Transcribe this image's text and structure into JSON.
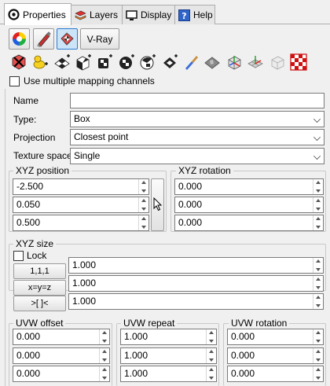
{
  "tabs": [
    {
      "label": "Properties",
      "icon": "properties-icon",
      "active": true
    },
    {
      "label": "Layers",
      "icon": "layers-icon",
      "active": false
    },
    {
      "label": "Display",
      "icon": "display-icon",
      "active": false
    },
    {
      "label": "Help",
      "icon": "help-icon",
      "active": false
    }
  ],
  "toolbar": {
    "buttons": [
      "color-wheel-icon",
      "paint-tube-icon",
      "texture-mapping-icon"
    ],
    "vray_label": "V-Ray"
  },
  "mapping_icons": [
    "remove-mapping-icon",
    "add-mapping-icon",
    "planar-mapping-icon",
    "box-mapping-icon",
    "cylinder-mapping-icon",
    "sphere-mapping-icon",
    "surface-mapping-icon",
    "capped-mapping-icon",
    "brush-icon",
    "show-mapping-icon",
    "box-widget-icon",
    "grid-widget-icon",
    "grid-faded-icon",
    "checker-icon"
  ],
  "multi_channel": {
    "label": "Use multiple mapping channels",
    "checked": false
  },
  "props": {
    "name_label": "Name",
    "name_value": "",
    "type_label": "Type:",
    "type_value": "Box",
    "projection_label": "Projection",
    "projection_value": "Closest point",
    "texture_space_label": "Texture space",
    "texture_space_value": "Single"
  },
  "xyz_position": {
    "title": "XYZ position",
    "values": [
      "-2.500",
      "0.050",
      "0.500"
    ]
  },
  "xyz_rotation": {
    "title": "XYZ rotation",
    "values": [
      "0.000",
      "0.000",
      "0.000"
    ]
  },
  "xyz_size": {
    "title": "XYZ size",
    "lock_label": "Lock",
    "lock_checked": false,
    "buttons": [
      "1,1,1",
      "x=y=z",
      ">[ ]<"
    ],
    "values": [
      "1.000",
      "1.000",
      "1.000"
    ]
  },
  "uvw_offset": {
    "title": "UVW offset",
    "values": [
      "0.000",
      "0.000",
      "0.000"
    ]
  },
  "uvw_repeat": {
    "title": "UVW repeat",
    "values": [
      "1.000",
      "1.000",
      "1.000"
    ]
  },
  "uvw_rotation": {
    "title": "UVW rotation",
    "values": [
      "0.000",
      "0.000",
      "0.000"
    ]
  },
  "colors": {
    "accent": "#2a7bd2",
    "panel": "#f0f0f0"
  }
}
